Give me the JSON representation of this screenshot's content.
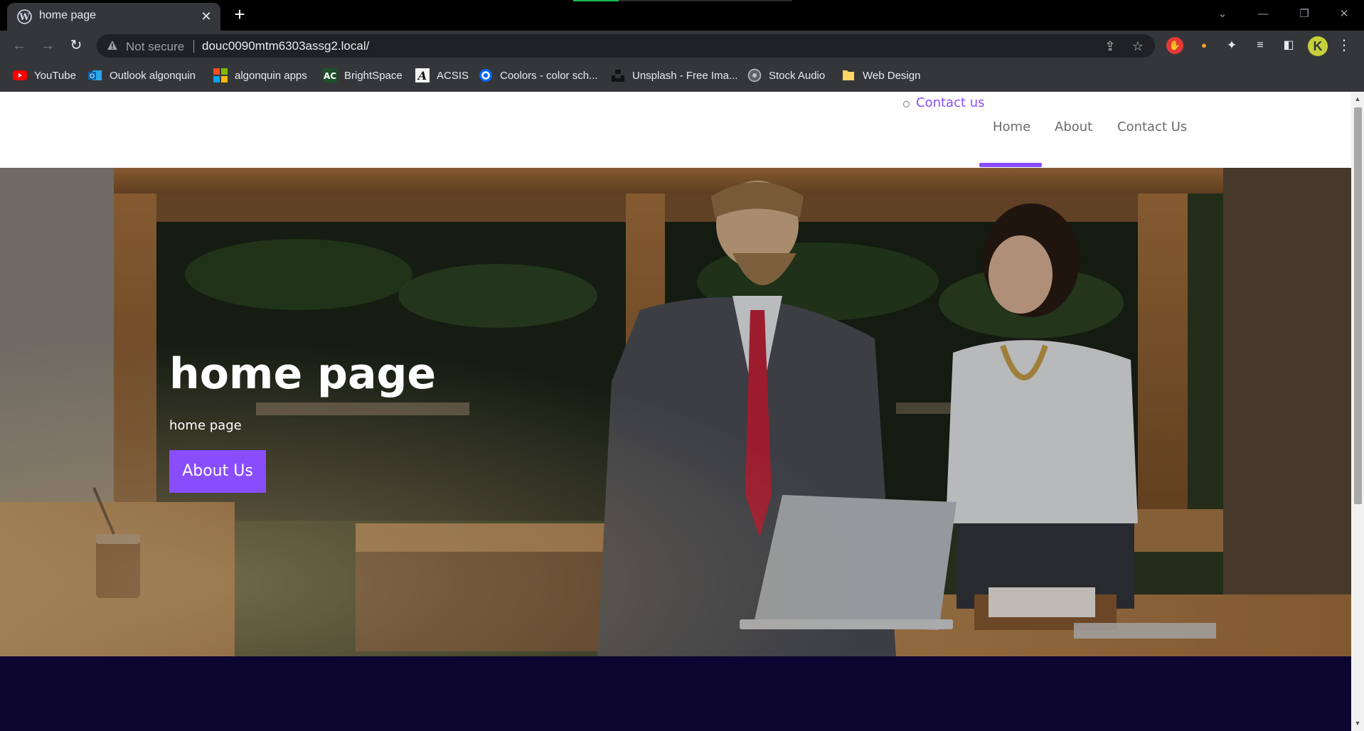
{
  "browser": {
    "tab_title": "home page",
    "not_secure_label": "Not secure",
    "url": "douc0090mtm6303assg2.local/",
    "bookmarks": [
      {
        "label": "YouTube",
        "icon": "youtube-icon"
      },
      {
        "label": "Outlook algonquin",
        "icon": "outlook-icon"
      },
      {
        "label": "algonquin apps",
        "icon": "microsoft-icon"
      },
      {
        "label": "BrightSpace",
        "icon": "brightspace-icon"
      },
      {
        "label": "ACSIS",
        "icon": "acsis-icon"
      },
      {
        "label": "Coolors - color sch...",
        "icon": "coolors-icon"
      },
      {
        "label": "Unsplash - Free Ima...",
        "icon": "unsplash-icon"
      },
      {
        "label": "Stock Audio",
        "icon": "stock-audio-icon"
      },
      {
        "label": "Web Design",
        "icon": "folder-icon"
      }
    ],
    "profile_initial": "K"
  },
  "site": {
    "submenu_contact": "Contact us",
    "nav": [
      {
        "label": "Home",
        "active": true
      },
      {
        "label": "About",
        "active": false
      },
      {
        "label": "Contact Us",
        "active": false
      }
    ],
    "hero": {
      "title": "home page",
      "subtitle": "home page",
      "button_label": "About Us"
    }
  },
  "colors": {
    "accent": "#8a4dfc",
    "footer": "#0c0530",
    "chrome_dark": "#35363a"
  }
}
